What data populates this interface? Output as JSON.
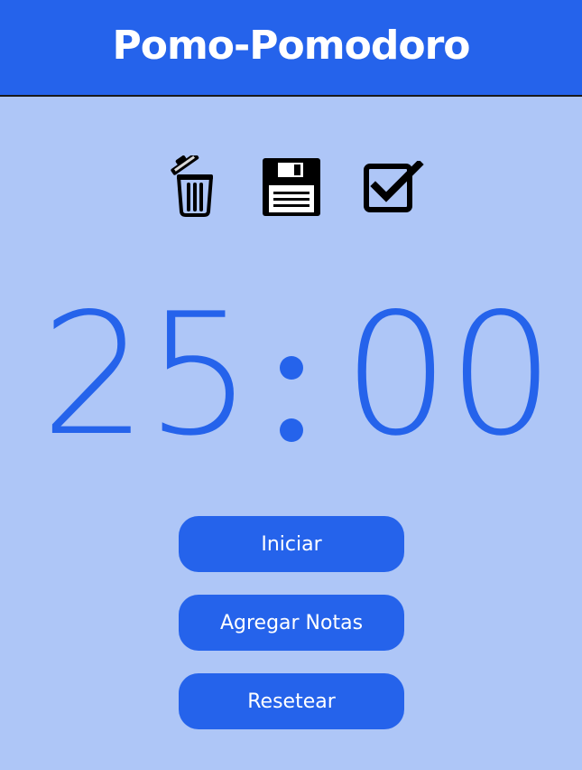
{
  "app": {
    "title": "Pomo-Pomodoro"
  },
  "toolbar": {
    "icons": [
      "trash-icon",
      "save-icon",
      "check-square-icon"
    ]
  },
  "timer": {
    "minutes": "25",
    "seconds": "00"
  },
  "actions": {
    "start_label": "Iniciar",
    "notes_label": "Agregar Notas",
    "reset_label": "Resetear"
  },
  "colors": {
    "header_bg": "#2563eb",
    "page_bg": "#aec6f7",
    "accent": "#2563eb",
    "text_light": "#ffffff"
  }
}
